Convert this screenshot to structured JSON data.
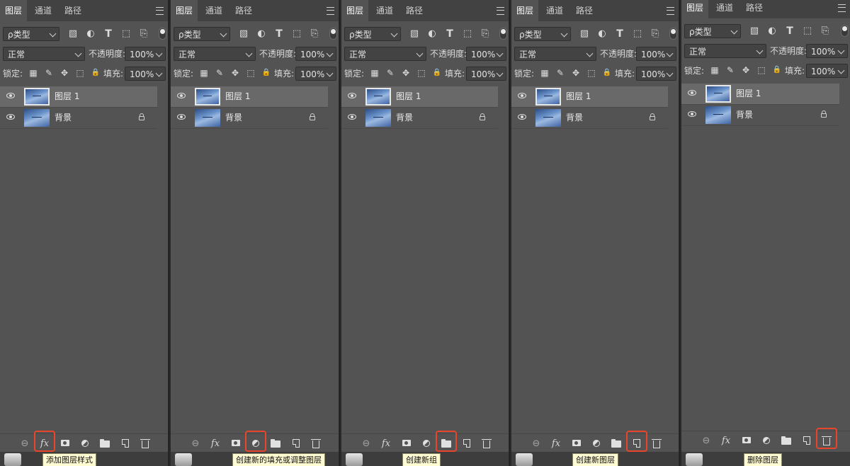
{
  "tabs": [
    "图层",
    "通道",
    "路径"
  ],
  "filter": {
    "kind_label": "ρ类型"
  },
  "blend_mode": "正常",
  "opacity_label": "不透明度:",
  "opacity_value": "100%",
  "lock_label": "锁定:",
  "fill_label": "填充:",
  "fill_value": "100%",
  "layers": [
    {
      "name": "图层 1",
      "selected": true,
      "locked": false
    },
    {
      "name": "背景",
      "selected": false,
      "locked": true
    }
  ],
  "bottom_icons": [
    "link-icon",
    "fx-icon",
    "mask-icon",
    "adjustment-icon",
    "folder-icon",
    "new-layer-icon",
    "trash-icon"
  ],
  "fx_glyph": "fx",
  "panels": [
    {
      "highlight": "fx-icon",
      "tooltip": "添加图层样式"
    },
    {
      "highlight": "adjustment-icon",
      "tooltip": "创建新的填充或调整图层"
    },
    {
      "highlight": "folder-icon",
      "tooltip": "创建新组"
    },
    {
      "highlight": "new-layer-icon",
      "tooltip": "创建新图层"
    },
    {
      "highlight": "trash-icon",
      "tooltip": "删除图层"
    }
  ],
  "colors": {
    "highlight": "#e8452a",
    "tooltip_bg": "#fffbd2",
    "panel_bg": "#535353"
  }
}
